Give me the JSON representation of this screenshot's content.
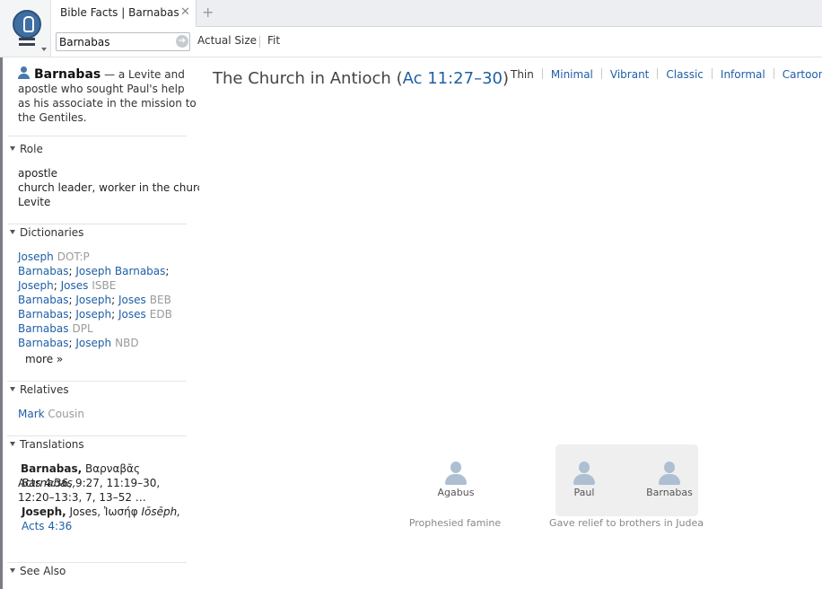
{
  "tab": {
    "title": "Bible Facts | Barnabas",
    "close": "✕",
    "new_tab": "+"
  },
  "toolbar": {
    "search_value": "Barnabas",
    "actual_size": "Actual Size",
    "fit": "Fit"
  },
  "sidebar": {
    "intro": {
      "name": "Barnabas",
      "description": " — a Levite and apostle who sought Paul's help as his associate in the mission to the Gentiles."
    },
    "role": {
      "heading": "Role",
      "items": [
        "apostle",
        "church leader, worker in the church",
        "Levite"
      ]
    },
    "dictionaries": {
      "heading": "Dictionaries",
      "lines": [
        {
          "links": [
            "Joseph"
          ],
          "source": "DOT:P"
        },
        {
          "links": [
            "Barnabas",
            "Joseph Barnabas"
          ],
          "source": ""
        },
        {
          "links": [
            "Joseph",
            "Joses"
          ],
          "source": "ISBE"
        },
        {
          "links": [
            "Barnabas",
            "Joseph",
            "Joses"
          ],
          "source": "BEB"
        },
        {
          "links": [
            "Barnabas",
            "Joseph",
            "Joses"
          ],
          "source": "EDB"
        },
        {
          "links": [
            "Barnabas"
          ],
          "source": "DPL"
        },
        {
          "links": [
            "Barnabas",
            "Joseph"
          ],
          "source": "NBD"
        }
      ],
      "more": "more »"
    },
    "relatives": {
      "heading": "Relatives",
      "name": "Mark",
      "relation": "Cousin"
    },
    "translations": {
      "heading": "Translations",
      "line1": {
        "name": "Barnabas,",
        "greek": " Βαρναβᾶς ",
        "translit": "Barnabas,",
        "refs": "Acts 4:36, 9:27, 11:19–30, 12:20–13:3, 7, 13–52 …"
      },
      "line2": {
        "name": "Joseph,",
        "plain": " Joses, Ἰωσήφ ",
        "translit": "Iōsēph,",
        "refs": "Acts 4:36"
      }
    },
    "see_also": {
      "heading": "See Also"
    }
  },
  "main": {
    "title_prefix": "The Church in Antioch (",
    "title_ref": "Ac 11:27–30",
    "title_suffix": ")",
    "styles": [
      "Thin",
      "Minimal",
      "Vibrant",
      "Classic",
      "Informal",
      "Cartoon"
    ],
    "active_style": "Thin",
    "nodes": {
      "agabus": "Agabus",
      "paul": "Paul",
      "barnabas": "Barnabas"
    },
    "captions": {
      "agabus_event": "Prophesied famine",
      "relief_event": "Gave relief to brothers in Judea"
    }
  }
}
